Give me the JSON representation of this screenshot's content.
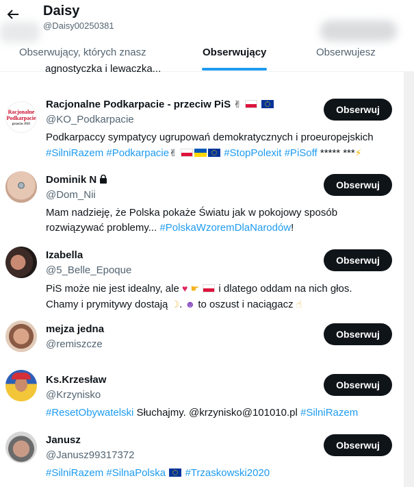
{
  "header": {
    "title": "Daisy",
    "handle": "@Daisy00250381"
  },
  "tabs": [
    {
      "label": "Obserwujący, których znasz"
    },
    {
      "label": "Obserwujący"
    },
    {
      "label": "Obserwujesz"
    }
  ],
  "cut_text": "agnostyczka i lewaczka...",
  "follow_label": "Obserwuj",
  "users": [
    {
      "name": "Racjonalne Podkarpacie - przeciw PiS",
      "handle": "@KO_Podkarpacie",
      "bio_1": "Podkarpaccy sympatycy ugrupowań demokratycznych i proeuropejskich",
      "tags": [
        "#SilniRazem",
        "#Podkarpacie",
        "#StopPolexit",
        "#PiSoff"
      ],
      "bio_tail": " ***** ***",
      "logo_line1": "Racjonalne",
      "logo_line2": "Podkarpacie",
      "logo_line3": "przeciw PiS!"
    },
    {
      "name": "Dominik N",
      "handle": "@Dom_Nii",
      "bio_1": "Mam nadzieję, że Polska pokaże Światu jak w pokojowy sposób",
      "bio_2": "rozwiązywać problemy... ",
      "tag": "#PolskaWzoremDlaNarodów",
      "bio_end": "!"
    },
    {
      "name": "Izabella",
      "handle": "@5_Belle_Epoque",
      "bio_1a": "PiS może nie jest idealny, ale",
      "bio_1b": "i dlatego oddam na nich głos.",
      "bio_2a": "Chamy i prymitywy dostają",
      "bio_2b": "to oszust i naciągacz"
    },
    {
      "name": "mejza jedna",
      "handle": "@remiszcze"
    },
    {
      "name": "Ks.Krzesław",
      "handle": "@Krzynisko",
      "tag1": "#ResetObywatelski",
      "text": " Słuchajmy. @krzynisko@101010.pl ",
      "tag2": "#SilniRazem"
    },
    {
      "name": "Janusz",
      "handle": "@Janusz99317372",
      "tag1": "#SilniRazem",
      "tag2": "#SilnaPolska",
      "tag3": "#Trzaskowski2020"
    }
  ]
}
